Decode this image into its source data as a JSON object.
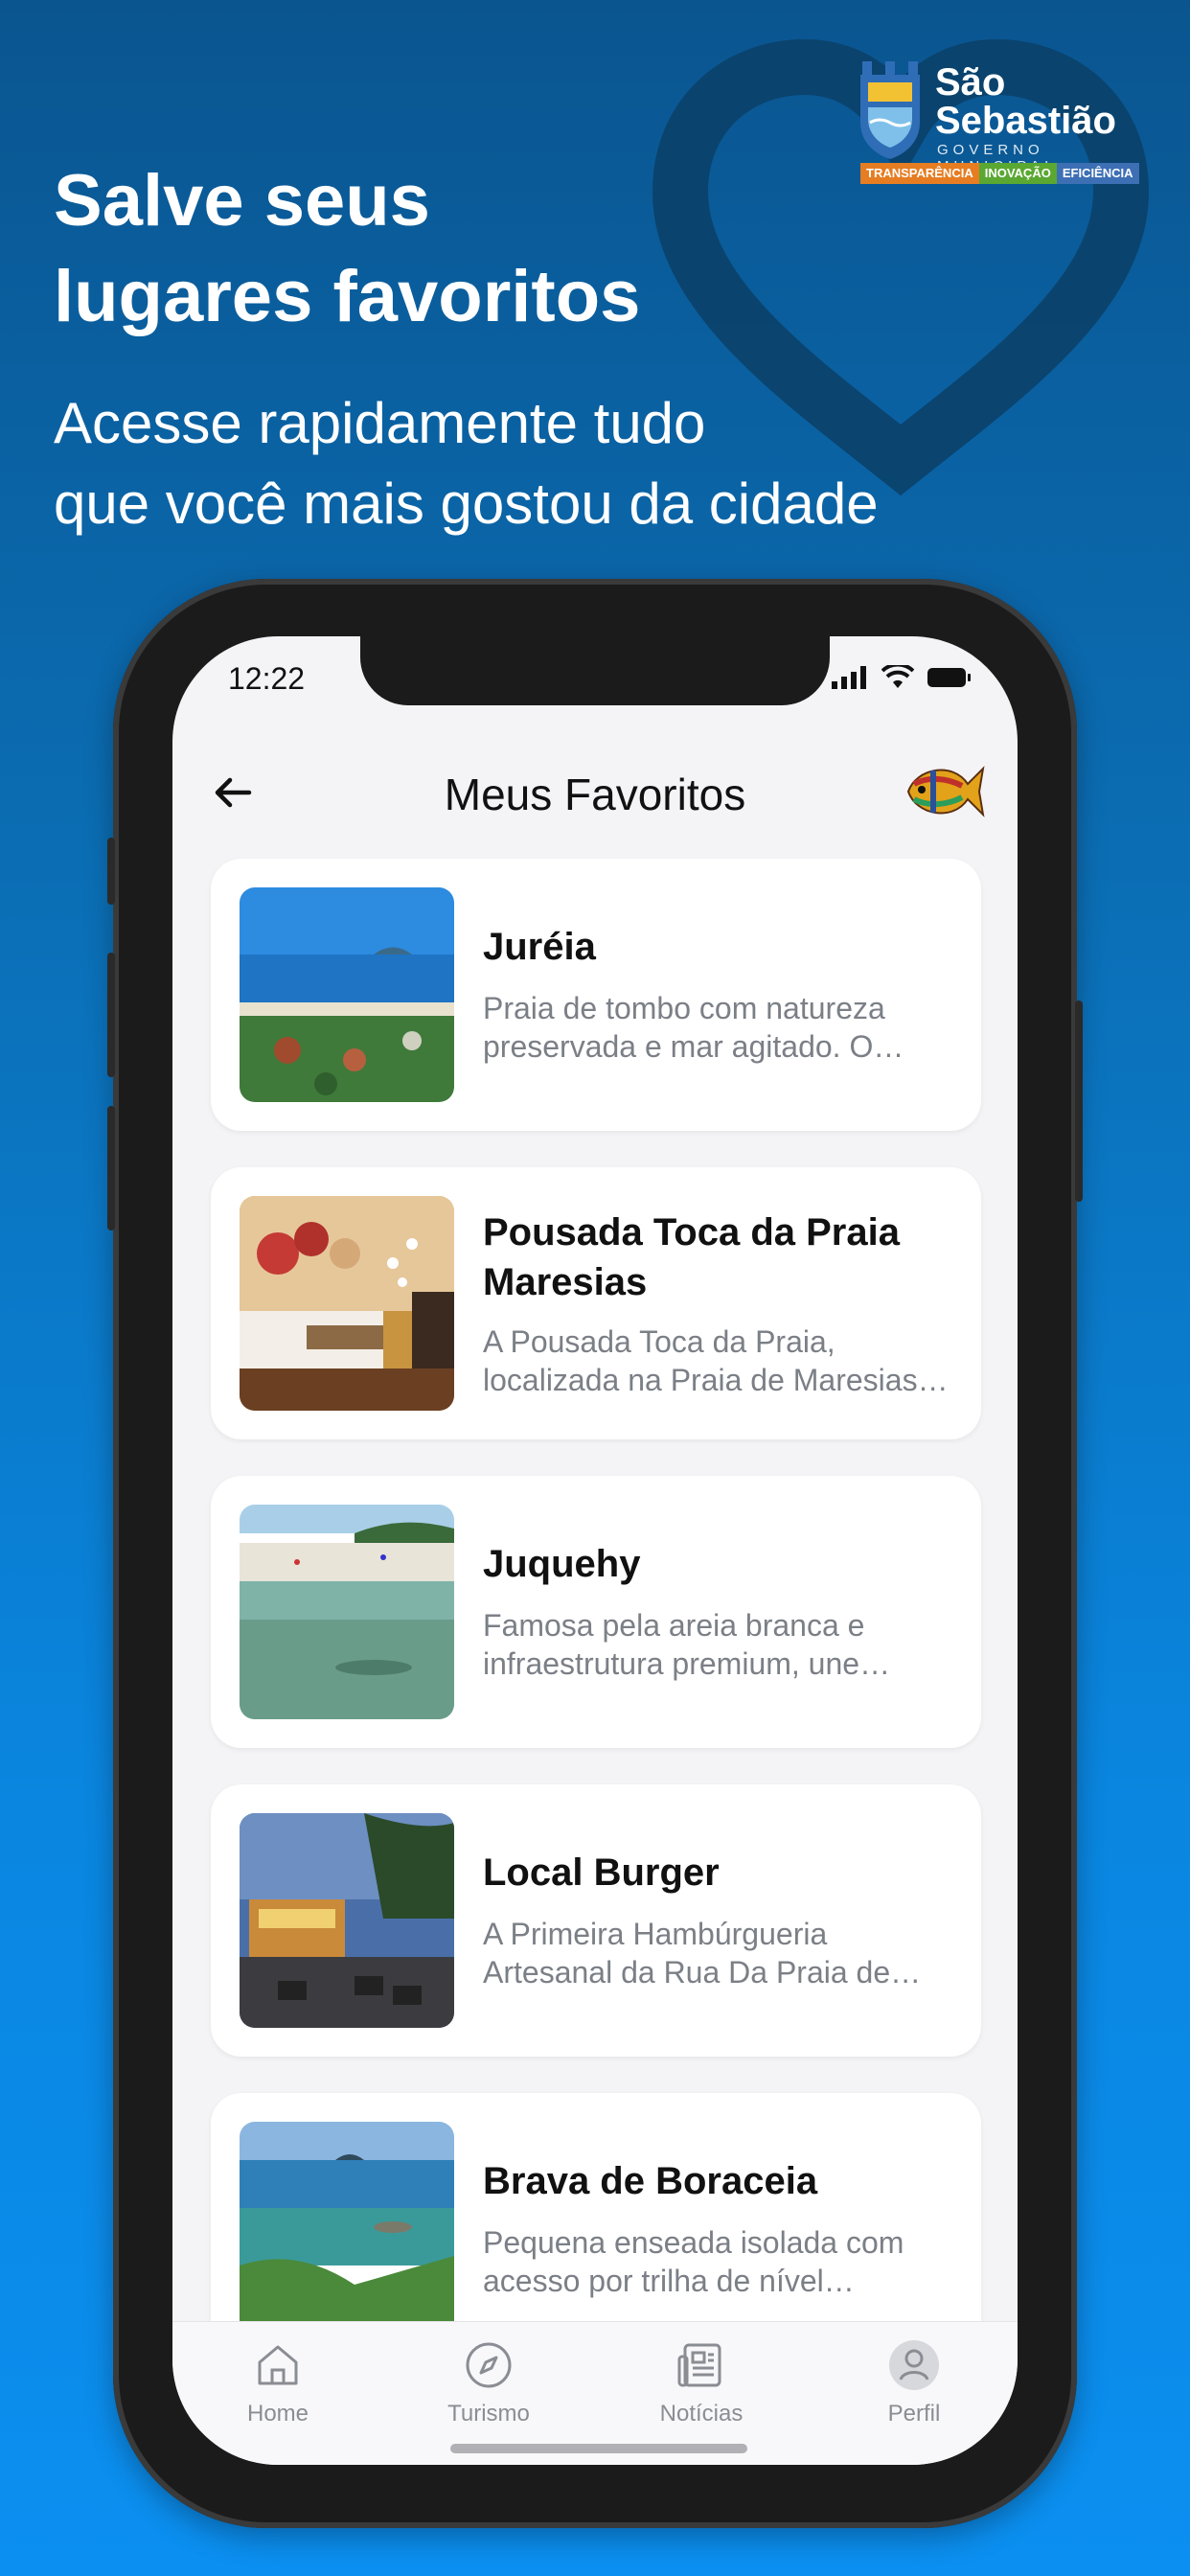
{
  "promo": {
    "headline_line1": "Salve seus",
    "headline_line2": "lugares favoritos",
    "subheadline_line1": "Acesse rapidamente tudo",
    "subheadline_line2": "que você mais gostou da cidade"
  },
  "logo": {
    "name_line1": "São",
    "name_line2": "Sebastião",
    "subtitle": "GOVERNO MUNICIPAL",
    "tags": [
      "TRANSPARÊNCIA",
      "INOVAÇÃO",
      "EFICIÊNCIA"
    ]
  },
  "status_bar": {
    "time": "12:22"
  },
  "header": {
    "title": "Meus Favoritos",
    "back_icon": "arrow-left-icon",
    "logo_icon": "fish-icon"
  },
  "favorites": [
    {
      "title": "Juréia",
      "description": "Praia de tombo com natureza preservada e mar agitado. O diferencial da praia"
    },
    {
      "title": "Pousada Toca da Praia Maresias",
      "description": "A Pousada Toca da Praia, localizada na Praia de Maresias, é um lugar aconchegante"
    },
    {
      "title": "Juquehy",
      "description": "Famosa pela areia branca e infraestrutura premium, une charme e tranquilidade"
    },
    {
      "title": "Local Burger",
      "description": "A Primeira Hambúrgueria Artesanal da Rua Da Praia de Maresias"
    },
    {
      "title": "Brava de Boraceia",
      "description": "Pequena enseada isolada com acesso por trilha de nível moderado"
    }
  ],
  "tabbar": {
    "items": [
      {
        "label": "Home",
        "icon": "home-icon"
      },
      {
        "label": "Turismo",
        "icon": "compass-icon"
      },
      {
        "label": "Notícias",
        "icon": "newspaper-icon"
      },
      {
        "label": "Perfil",
        "icon": "profile-icon"
      }
    ]
  }
}
